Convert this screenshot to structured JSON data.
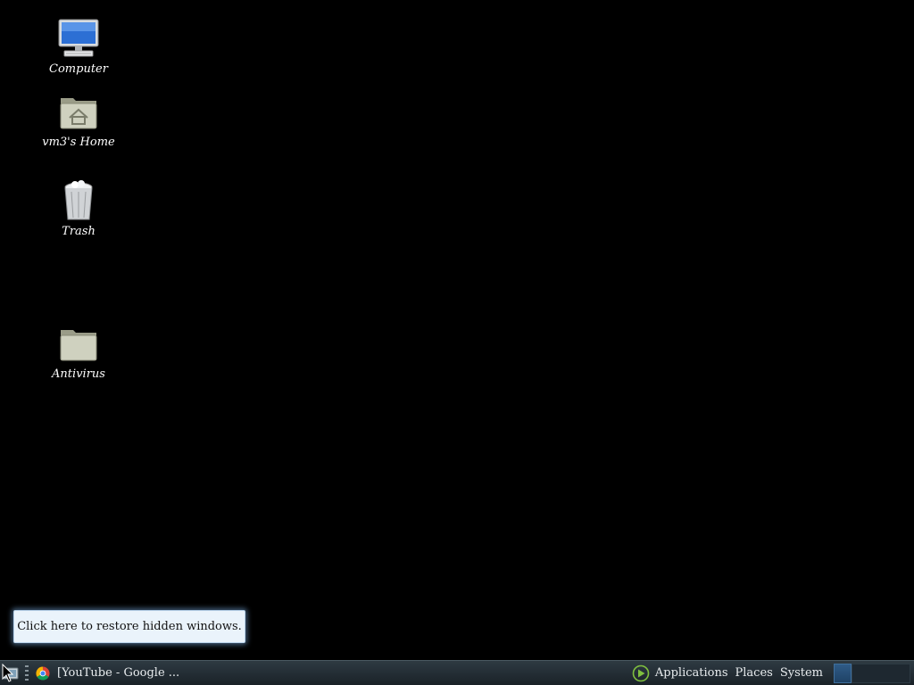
{
  "desktop": {
    "icons": [
      {
        "label": "Computer",
        "icon": "computer-icon"
      },
      {
        "label": "vm3's Home",
        "icon": "home-folder-icon"
      },
      {
        "label": "Trash",
        "icon": "trash-icon"
      },
      {
        "label": "Antivirus",
        "icon": "folder-icon"
      }
    ]
  },
  "tooltip": {
    "text": "Click here to restore hidden windows."
  },
  "panel": {
    "task": {
      "label": "[YouTube - Google ..."
    },
    "menus": {
      "applications": "Applications",
      "places": "Places",
      "system": "System"
    }
  }
}
